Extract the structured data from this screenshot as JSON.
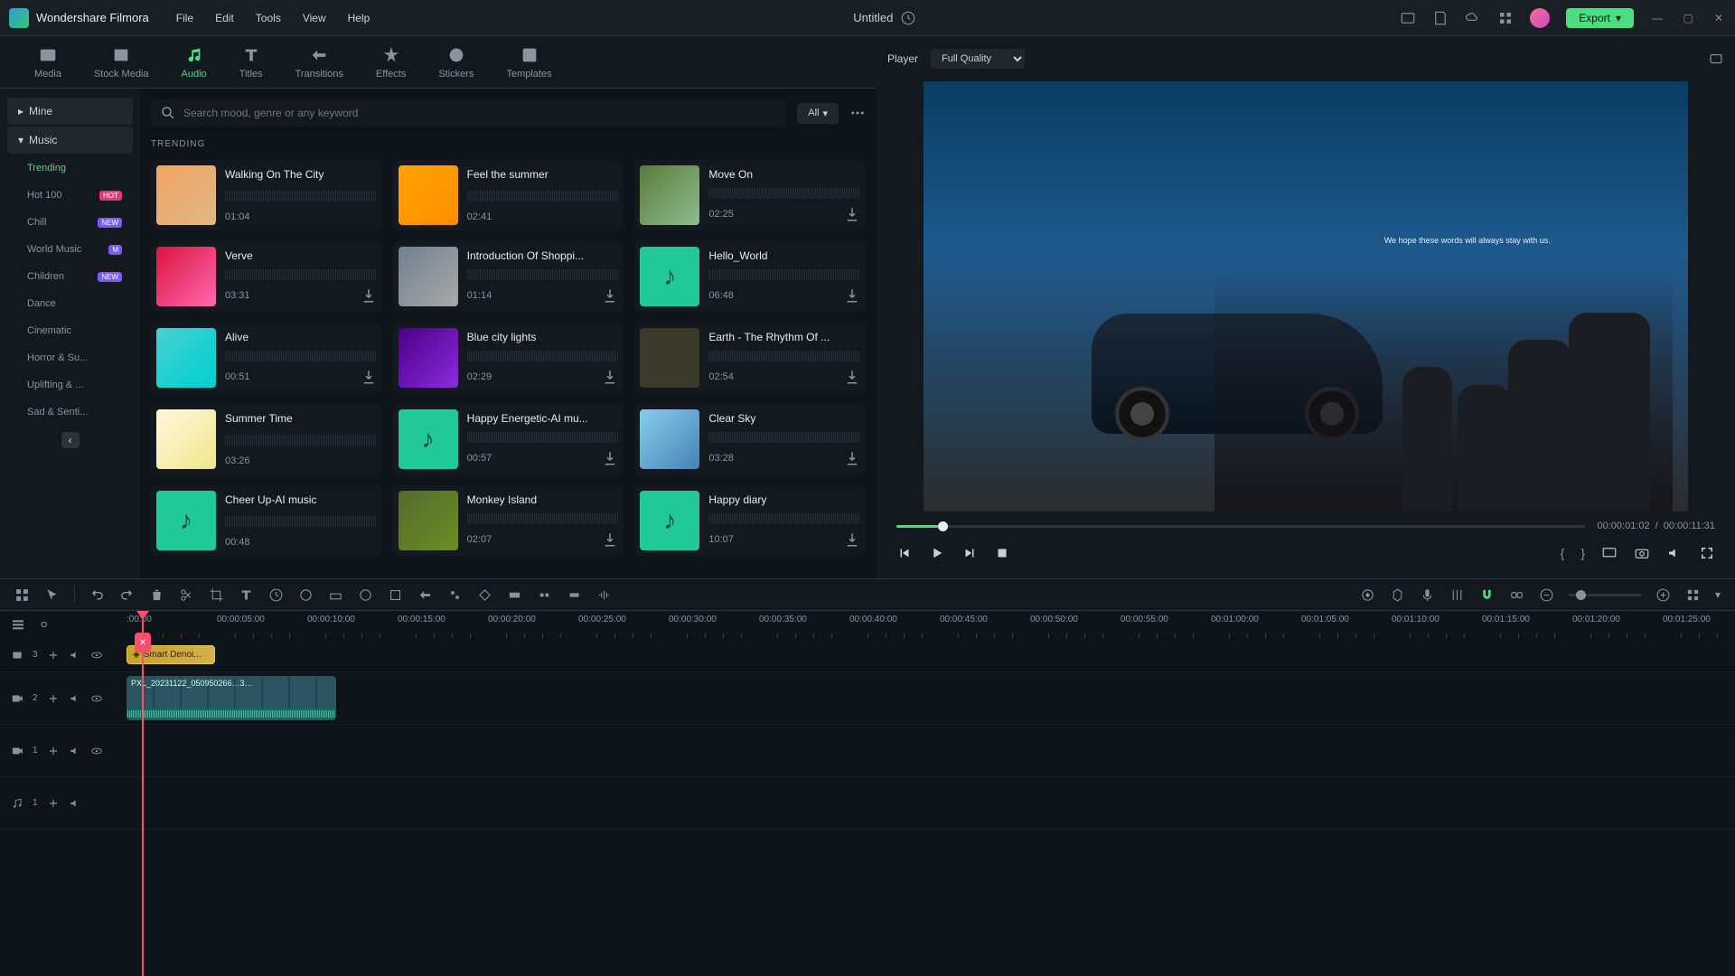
{
  "app_name": "Wondershare Filmora",
  "menu": [
    "File",
    "Edit",
    "Tools",
    "View",
    "Help"
  ],
  "document_name": "Untitled",
  "export_label": "Export",
  "tabs": [
    {
      "id": "media",
      "label": "Media"
    },
    {
      "id": "stock",
      "label": "Stock Media"
    },
    {
      "id": "audio",
      "label": "Audio"
    },
    {
      "id": "titles",
      "label": "Titles"
    },
    {
      "id": "transitions",
      "label": "Transitions"
    },
    {
      "id": "effects",
      "label": "Effects"
    },
    {
      "id": "stickers",
      "label": "Stickers"
    },
    {
      "id": "templates",
      "label": "Templates"
    }
  ],
  "active_tab": "audio",
  "sidebar": {
    "top": [
      {
        "label": "Mine"
      },
      {
        "label": "Music"
      }
    ],
    "items": [
      {
        "label": "Trending",
        "active": true
      },
      {
        "label": "Hot 100",
        "badge": "HOT",
        "btype": "hot"
      },
      {
        "label": "Chill",
        "badge": "NEW",
        "btype": "new"
      },
      {
        "label": "World Music",
        "badge": "M",
        "btype": "m"
      },
      {
        "label": "Children",
        "badge": "NEW",
        "btype": "new"
      },
      {
        "label": "Dance"
      },
      {
        "label": "Cinematic"
      },
      {
        "label": "Horror & Su..."
      },
      {
        "label": "Uplifting & ..."
      },
      {
        "label": "Sad & Senti..."
      }
    ]
  },
  "search_placeholder": "Search mood, genre or any keyword",
  "filter_label": "All",
  "section_heading": "TRENDING",
  "tracks": [
    {
      "title": "Walking On The City",
      "len": "01:04",
      "thumb": "a",
      "dl": false
    },
    {
      "title": "Feel the summer",
      "len": "02:41",
      "thumb": "b",
      "dl": false
    },
    {
      "title": "Move On",
      "len": "02:25",
      "thumb": "c",
      "dl": true
    },
    {
      "title": "Verve",
      "len": "03:31",
      "thumb": "d",
      "dl": true
    },
    {
      "title": "Introduction Of Shoppi...",
      "len": "01:14",
      "thumb": "e",
      "dl": true
    },
    {
      "title": "Hello_World",
      "len": "06:48",
      "thumb": "f",
      "dl": true
    },
    {
      "title": "Alive",
      "len": "00:51",
      "thumb": "g",
      "dl": true
    },
    {
      "title": "Blue city lights",
      "len": "02:29",
      "thumb": "h",
      "dl": true
    },
    {
      "title": "Earth - The Rhythm Of ...",
      "len": "02:54",
      "thumb": "i",
      "dl": true
    },
    {
      "title": "Summer Time",
      "len": "03:26",
      "thumb": "j",
      "dl": false
    },
    {
      "title": "Happy Energetic-AI mu...",
      "len": "00:57",
      "thumb": "f",
      "dl": true
    },
    {
      "title": "Clear Sky",
      "len": "03:28",
      "thumb": "k",
      "dl": true
    },
    {
      "title": "Cheer Up-AI music",
      "len": "00:48",
      "thumb": "f",
      "dl": false
    },
    {
      "title": "Monkey Island",
      "len": "02:07",
      "thumb": "l",
      "dl": true
    },
    {
      "title": "Happy diary",
      "len": "10:07",
      "thumb": "f",
      "dl": true
    }
  ],
  "player": {
    "label": "Player",
    "quality": "Full Quality",
    "overlay_text": "We hope these words will always stay with us.",
    "current": "00:00:01:02",
    "sep": "/",
    "total": "00:00:11:31"
  },
  "timeline": {
    "marks": [
      ":00:00",
      "00:00:05:00",
      "00:00:10:00",
      "00:00:15:00",
      "00:00:20:00",
      "00:00:25:00",
      "00:00:30:00",
      "00:00:35:00",
      "00:00:40:00",
      "00:00:45:00",
      "00:00:50:00",
      "00:00:55:00",
      "00:01:00:00",
      "00:01:05:00",
      "00:01:10:00",
      "00:01:15:00",
      "00:01:20:00",
      "00:01:25:00"
    ],
    "effect_clip": "Smart Denoi...",
    "video_clip": "PXL_20231122_050950266…3…",
    "tracks": [
      {
        "icon": "fx",
        "num": "3"
      },
      {
        "icon": "vid",
        "num": "2"
      },
      {
        "icon": "vid",
        "num": "1"
      },
      {
        "icon": "aud",
        "num": "1"
      }
    ]
  }
}
